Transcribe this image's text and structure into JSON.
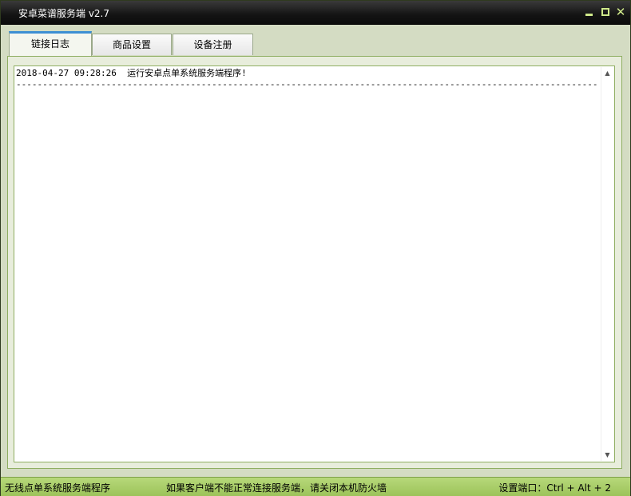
{
  "window": {
    "title": "安卓菜谱服务端 v2.7",
    "minimize_glyph": "minimize",
    "maximize_glyph": "maximize",
    "close_label": "✕"
  },
  "tabs": [
    {
      "label": "链接日志",
      "active": true
    },
    {
      "label": "商品设置",
      "active": false
    },
    {
      "label": "设备注册",
      "active": false
    }
  ],
  "log": {
    "lines": [
      "2018-04-27 09:28:26  运行安卓点单系统服务端程序!"
    ],
    "separator": "----------------------------------------------------------------------------------------------------------------------------"
  },
  "scrollbar": {
    "up_label": "▲",
    "down_label": "▼"
  },
  "status": {
    "left": "无线点单系统服务端程序",
    "middle": "如果客户端不能正常连接服务端，请关闭本机防火墙",
    "right": "设置端口：Ctrl + Alt + 2"
  },
  "colors": {
    "titlebar": "#141414",
    "accent_green": "#9cc35a",
    "tab_active_indicator": "#3d8fd3",
    "panel_border": "#8fae62"
  }
}
